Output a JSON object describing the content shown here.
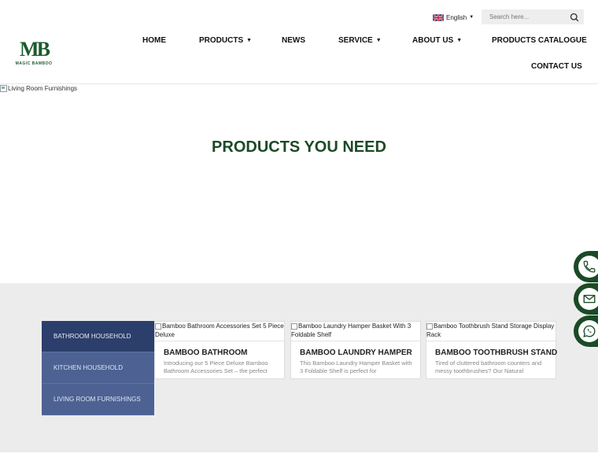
{
  "header": {
    "logo": {
      "mark": "MB",
      "tagline": "MAGIC BAMBOO"
    },
    "language": {
      "label": "English"
    },
    "search": {
      "placeholder": "Search here..."
    }
  },
  "nav": {
    "home": "HOME",
    "products": "PRODUCTS",
    "news": "NEWS",
    "service": "SERVICE",
    "about": "ABOUT US",
    "catalogue": "PRODUCTS CATALOGUE",
    "contact": "CONTACT US"
  },
  "banner": {
    "alt_text": "Living Room Furnishings"
  },
  "section": {
    "title": "PRODUCTS YOU NEED"
  },
  "categories": [
    {
      "label": "BATHROOM HOUSEHOLD"
    },
    {
      "label": "KITCHEN HOUSEHOLD"
    },
    {
      "label": "LIVING ROOM FURNISHINGS"
    }
  ],
  "products": [
    {
      "image_alt": "Bamboo Bathroom Accessories Set 5 Piece Deluxe",
      "title": "BAMBOO BATHROOM",
      "desc": "Introducing our 5 Piece Deluxe Bamboo Bathroom Accessories Set – the perfect"
    },
    {
      "image_alt": "Bamboo Laundry Hamper Basket With 3 Foldable Shelf",
      "title": "BAMBOO LAUNDRY HAMPER",
      "desc": "This Bamboo Laundry Hamper Basket with 3 Foldable Shelf is perfect for"
    },
    {
      "image_alt": "Bamboo Toothbrush Stand Storage Display Rack",
      "title": "BAMBOO TOOTHBRUSH STAND",
      "desc": "Tired of cluttered bathroom counters and messy toothbrushes? Our Natural"
    }
  ],
  "floating": {
    "icons": [
      "phone-icon",
      "mail-icon",
      "whatsapp-icon"
    ]
  },
  "colors": {
    "brand_green": "#1c4a26",
    "category_active": "#2c3e6b",
    "category": "#4d6293",
    "band": "#ececec"
  }
}
